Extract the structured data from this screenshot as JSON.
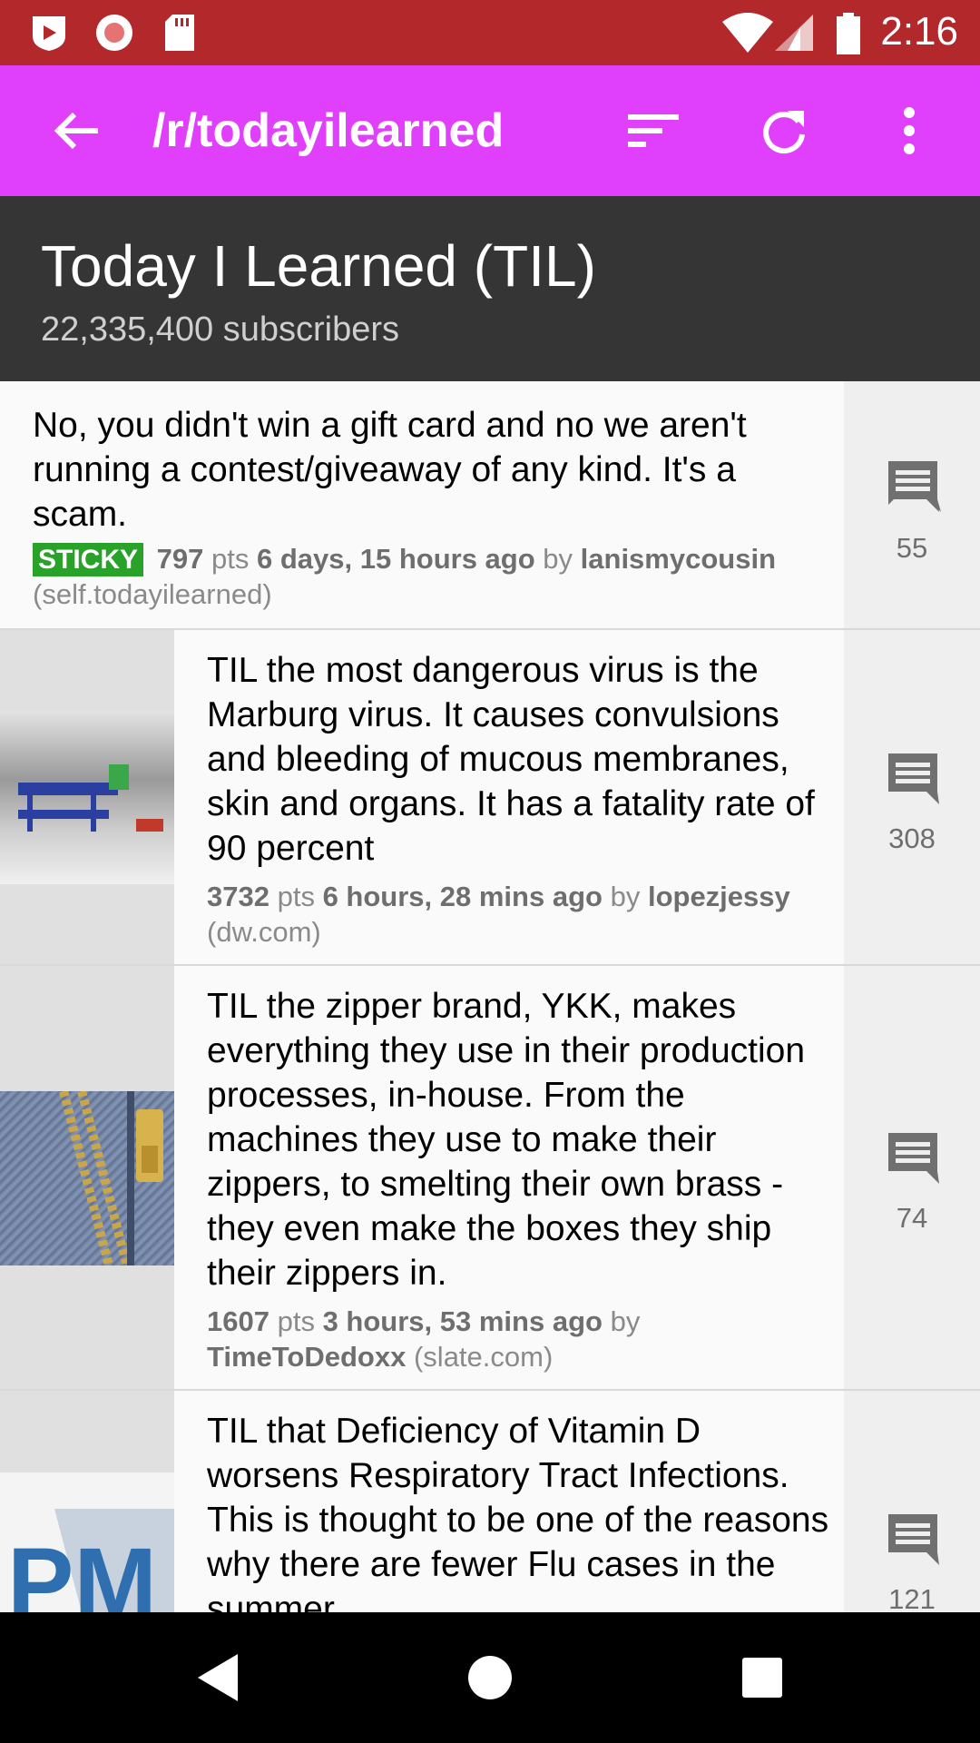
{
  "status_bar": {
    "time": "2:16",
    "icons": [
      "play-shield-icon",
      "record-icon",
      "sd-card-icon",
      "wifi-icon",
      "signal-icon",
      "battery-icon"
    ]
  },
  "app_bar": {
    "title": "/r/todayilearned",
    "background": "#e040fb",
    "actions": [
      "back-arrow-icon",
      "sort-icon",
      "refresh-icon",
      "overflow-menu-icon"
    ]
  },
  "subreddit": {
    "name": "Today I Learned (TIL)",
    "subscribers": "22,335,400 subscribers"
  },
  "posts": [
    {
      "title": "No, you didn't win a gift card and no we aren't running a contest/giveaway of any kind. It's a scam.",
      "sticky_label": "STICKY",
      "points": "797",
      "pts_label": "pts",
      "age": "6 days, 15 hours ago",
      "by_label": "by",
      "author": "lanismycousin",
      "domain": "(self.todayilearned)",
      "comments": "55",
      "has_thumb": false
    },
    {
      "title": "TIL the most dangerous virus is the Marburg virus. It causes convulsions and bleeding of mucous membranes, skin and organs. It has a fatality rate of 90 percent",
      "points": "3732",
      "pts_label": "pts",
      "age": "6 hours, 28 mins ago",
      "by_label": "by",
      "author": "lopezjessy",
      "domain": "(dw.com)",
      "comments": "308",
      "has_thumb": true
    },
    {
      "title": "TIL the zipper brand, YKK, makes everything they use in their production processes, in-house. From the machines they use to make their zippers, to smelting their own brass - they even make the boxes they ship their zippers in.",
      "points": "1607",
      "pts_label": "pts",
      "age": "3 hours, 53 mins ago",
      "by_label": "by",
      "author": "TimeToDedoxx",
      "domain": "(slate.com)",
      "comments": "74",
      "has_thumb": true
    },
    {
      "title": "TIL that Deficiency of Vitamin D worsens Respiratory Tract Infections. This is thought to be one of the reasons why there are fewer Flu cases in the summer",
      "comments": "121",
      "has_thumb": true,
      "thumb_text": "PM"
    }
  ],
  "nav_bar": [
    "back-triangle-icon",
    "home-circle-icon",
    "recents-square-icon"
  ]
}
